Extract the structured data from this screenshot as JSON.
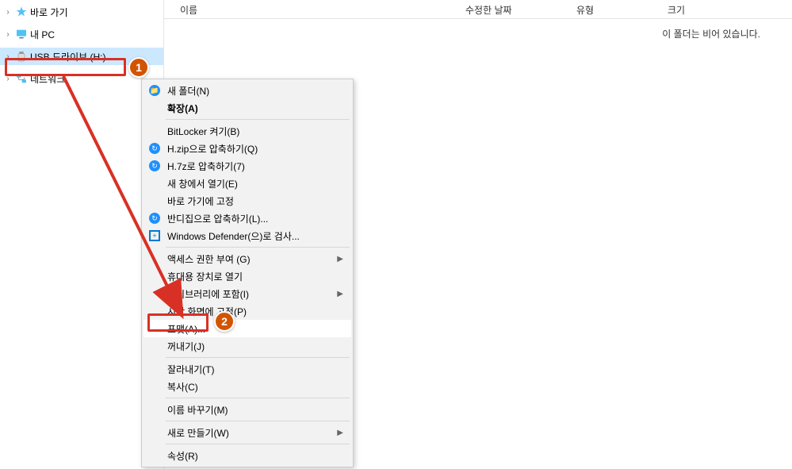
{
  "sidebar": {
    "items": [
      {
        "label": "바로 가기",
        "expand": ">",
        "icon": "star"
      },
      {
        "label": "내 PC",
        "expand": ">",
        "icon": "pc"
      },
      {
        "label": "USB 드라이브 (H:)",
        "expand": ">",
        "icon": "usb",
        "selected": true
      },
      {
        "label": "네트워크",
        "expand": ">",
        "icon": "net"
      }
    ]
  },
  "columns": {
    "name": "이름",
    "date": "수정한 날짜",
    "type": "유형",
    "size": "크기"
  },
  "empty_message": "이 폴더는 비어 있습니다.",
  "context_menu": {
    "groups": [
      [
        {
          "label": "새 폴더(N)",
          "icon": "folder"
        },
        {
          "label": "확장(A)",
          "bold": true
        }
      ],
      [
        {
          "label": "BitLocker 켜기(B)"
        },
        {
          "label": "H.zip으로 압축하기(Q)",
          "icon": "bandizip"
        },
        {
          "label": "H.7z로 압축하기(7)",
          "icon": "bandizip"
        },
        {
          "label": "새 창에서 열기(E)"
        },
        {
          "label": "바로 가기에 고정"
        },
        {
          "label": "반디집으로 압축하기(L)...",
          "icon": "bandizip"
        },
        {
          "label": "Windows Defender(으)로 검사...",
          "icon": "defender"
        }
      ],
      [
        {
          "label": "액세스 권한 부여 (G)",
          "submenu": true
        },
        {
          "label": "휴대용 장치로 열기"
        },
        {
          "label": "라이브러리에 포함(I)",
          "submenu": true
        },
        {
          "label": "시작 화면에 고정(P)"
        },
        {
          "label": "포맷(A)...",
          "highlight": true
        },
        {
          "label": "꺼내기(J)"
        }
      ],
      [
        {
          "label": "잘라내기(T)"
        },
        {
          "label": "복사(C)"
        }
      ],
      [
        {
          "label": "이름 바꾸기(M)"
        }
      ],
      [
        {
          "label": "새로 만들기(W)",
          "submenu": true
        }
      ],
      [
        {
          "label": "속성(R)"
        }
      ]
    ]
  },
  "badges": {
    "one": "1",
    "two": "2"
  }
}
